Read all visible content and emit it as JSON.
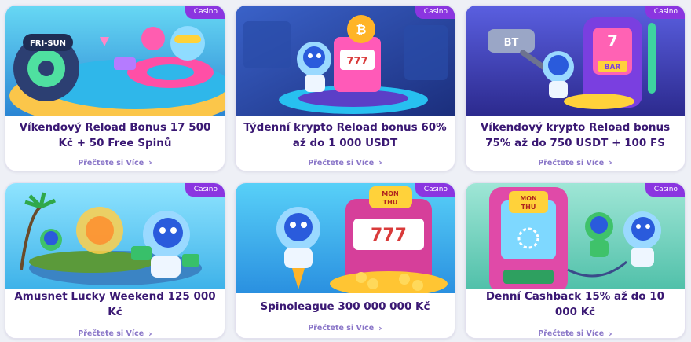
{
  "cards": [
    {
      "badge": "Casino",
      "title": "Víkendový Reload Bonus 17 500 Kč + 50 Free Spinů",
      "link": "Přečtete si Více",
      "art_text": "FRI-SUN"
    },
    {
      "badge": "Casino",
      "title": "Týdenní krypto Reload bonus 60% až do 1 000 USDT",
      "link": "Přečtete si Více",
      "art_text": "777"
    },
    {
      "badge": "Casino",
      "title": "Víkendový krypto Reload bonus 75% až do 750 USDT + 100 FS",
      "link": "Přečtete si Více",
      "art_text": "BT",
      "art_text2": "BAR"
    },
    {
      "badge": "Casino",
      "title": "Amusnet Lucky Weekend 125 000 Kč",
      "link": "Přečtete si Více"
    },
    {
      "badge": "Casino",
      "title": "Spinoleague 300 000 000 Kč",
      "link": "Přečtete si Více",
      "art_text": "MON THU",
      "art_text2": "777"
    },
    {
      "badge": "Casino",
      "title": "Denní Cashback 15% až do 10 000 Kč",
      "link": "Přečtete si Více",
      "art_text": "MON THU"
    }
  ],
  "icons": {
    "chevron": "chevron-right-icon"
  },
  "colors": {
    "badge": "#8b35e0",
    "title": "#3a1873",
    "link": "#8a76c8"
  }
}
